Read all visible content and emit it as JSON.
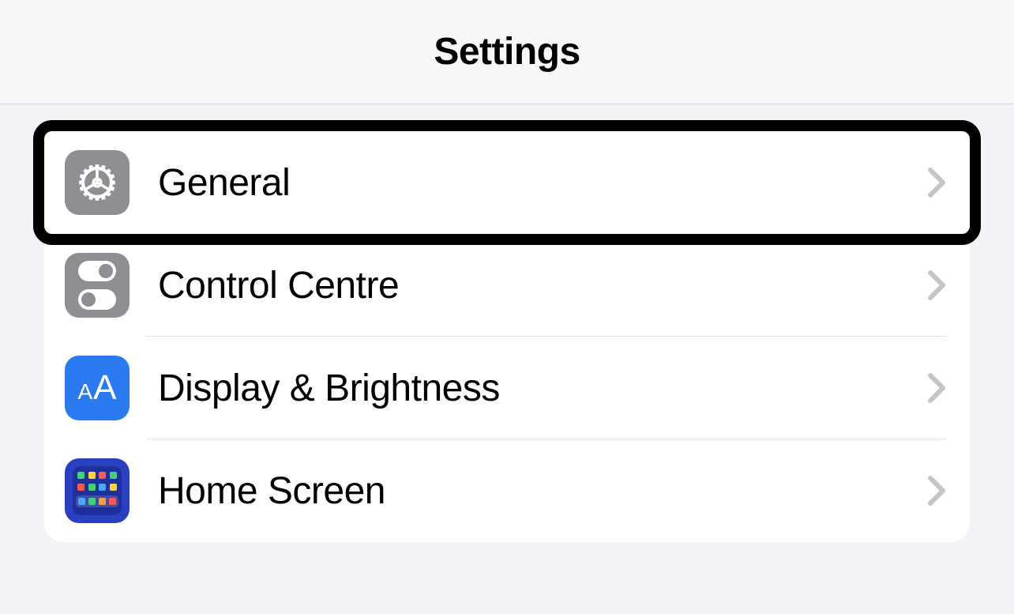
{
  "header": {
    "title": "Settings"
  },
  "rows": [
    {
      "label": "General",
      "icon": "gear-icon",
      "highlighted": true
    },
    {
      "label": "Control Centre",
      "icon": "toggles-icon",
      "highlighted": false
    },
    {
      "label": "Display & Brightness",
      "icon": "text-size-icon",
      "highlighted": false
    },
    {
      "label": "Home Screen",
      "icon": "home-screen-icon",
      "highlighted": false
    }
  ]
}
